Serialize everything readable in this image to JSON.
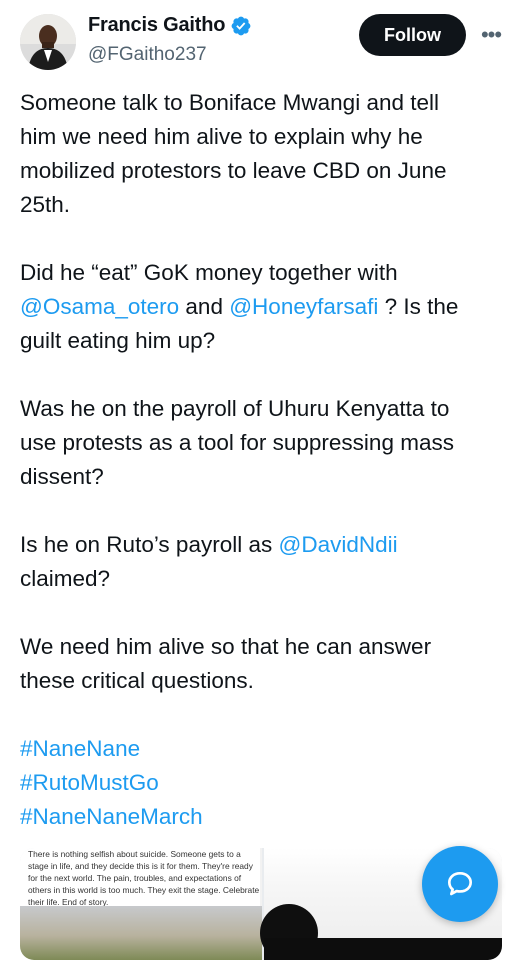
{
  "author": {
    "display_name": "Francis Gaitho",
    "handle": "@FGaitho237",
    "verified": true,
    "avatar_icon": "person-avatar"
  },
  "actions": {
    "follow_label": "Follow",
    "more_icon": "more-horizontal-icon",
    "more_label": "•••"
  },
  "tweet": {
    "p1": [
      "Someone talk to Boniface Mwangi and tell",
      "him we need him alive to explain why he",
      "mobilized protestors to leave CBD on June",
      "25th."
    ],
    "p2": {
      "line1": "Did he “eat” GoK money together with",
      "mention1": "@Osama_otero",
      "and": " and ",
      "mention2": "@Honeyfarsafi",
      "after": " ? Is the",
      "line3": "guilt eating him up?"
    },
    "p3": [
      "Was he on the payroll of Uhuru Kenyatta to",
      "use protests as a tool for suppressing mass",
      "dissent?"
    ],
    "p4": {
      "before": "Is he on Ruto’s payroll as ",
      "mention": "@DavidNdii",
      "line2": "claimed?"
    },
    "p5": [
      "We need him alive so that he can answer",
      "these critical questions."
    ],
    "hashtags": [
      "#NaneNane",
      "#RutoMustGo",
      "#NaneNaneMarch"
    ]
  },
  "media": {
    "caption": "There is nothing selfish about suicide. Someone gets to a stage in life, and they decide this is it for them. They're ready for the next world. The pain, troubles, and expectations of others in this world is too much. They exit the stage. Celebrate their life. End of story."
  },
  "fab": {
    "icon": "compose-reply-icon"
  },
  "colors": {
    "accent": "#1d9bf0",
    "text": "#0f1419",
    "muted": "#536471",
    "follow_bg": "#0f1419"
  }
}
